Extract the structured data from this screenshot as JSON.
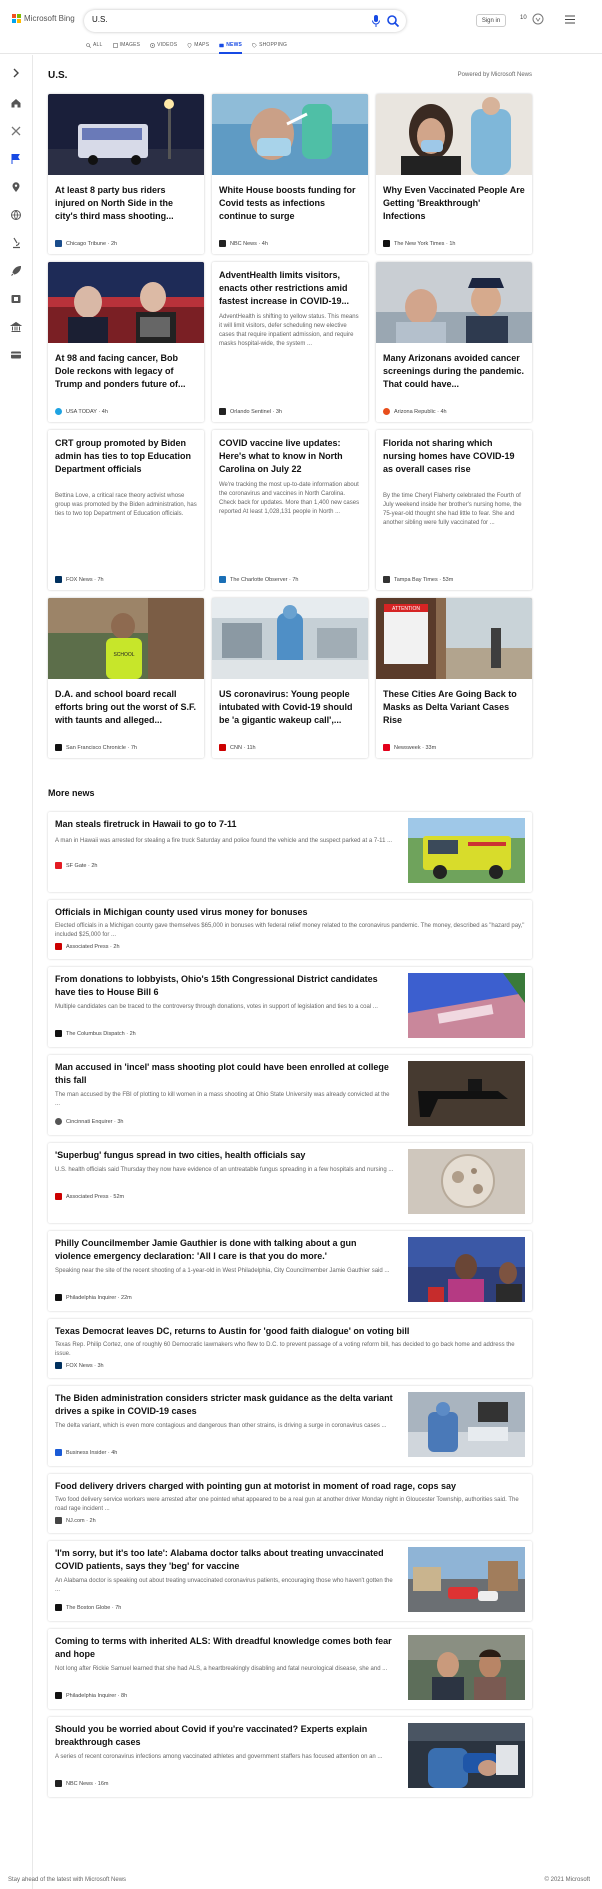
{
  "header": {
    "logo_text": "Microsoft Bing",
    "query": "U.S.",
    "signin": "Sign in",
    "rewards_points": "10",
    "tabs": [
      {
        "label": "ALL",
        "icon": "search-icon",
        "active": false
      },
      {
        "label": "IMAGES",
        "icon": "image-icon",
        "active": false
      },
      {
        "label": "VIDEOS",
        "icon": "video-icon",
        "active": false
      },
      {
        "label": "MAPS",
        "icon": "map-pin-icon",
        "active": false
      },
      {
        "label": "NEWS",
        "icon": "news-icon",
        "active": true
      },
      {
        "label": "SHOPPING",
        "icon": "tag-icon",
        "active": false
      }
    ]
  },
  "rail_icons": [
    "chevron-right-icon",
    "home-icon",
    "crosshair-icon",
    "flag-icon",
    "location-icon",
    "globe-icon",
    "microscope-icon",
    "rocket-icon",
    "film-icon",
    "building-icon",
    "card-icon"
  ],
  "section": {
    "title": "U.S.",
    "powered_by": "Powered by Microsoft News"
  },
  "top_cards": [
    {
      "title": "At least 8 party bus riders injured on North Side in the city's third mass shooting...",
      "source": "Chicago Tribune",
      "time": "2h",
      "fav": "#1a4c8b",
      "summary": ""
    },
    {
      "title": "White House boosts funding for Covid tests as infections continue to surge",
      "source": "NBC News",
      "time": "4h",
      "fav": "#222",
      "summary": ""
    },
    {
      "title": "Why Even Vaccinated People Are Getting 'Breakthrough' Infections",
      "source": "The New York Times",
      "time": "1h",
      "fav": "#111",
      "summary": ""
    },
    {
      "title": "At 98 and facing cancer, Bob Dole reckons with legacy of Trump and ponders future of...",
      "source": "USA TODAY",
      "time": "4h",
      "fav": "#1ea3e2",
      "summary": ""
    },
    {
      "title": "AdventHealth limits visitors, enacts other restrictions amid fastest increase in COVID-19...",
      "source": "Orlando Sentinel",
      "time": "3h",
      "fav": "#222",
      "summary": "AdventHealth is shifting to yellow status. This means it will limit visitors, defer scheduling new elective cases that require inpatient admission, and require masks hospital-wide, the system ..."
    },
    {
      "title": "Many Arizonans avoided cancer screenings during the pandemic. That could have...",
      "source": "Arizona Republic",
      "time": "4h",
      "fav": "#e84e1b",
      "summary": ""
    },
    {
      "title": "CRT group promoted by Biden admin has ties to top Education Department officials",
      "source": "FOX News",
      "time": "7h",
      "fav": "#00305e",
      "summary": "Bettina Love, a critical race theory activist whose group was promoted by the Biden administration, has ties to two top Department of Education officials."
    },
    {
      "title": "COVID vaccine live updates: Here's what to know in North Carolina on July 22",
      "source": "The Charlotte Observer",
      "time": "7h",
      "fav": "#1a6fb6",
      "summary": "We're tracking the most up-to-date information about the coronavirus and vaccines in North Carolina. Check back for updates. More than 1,400 new cases reported At least 1,028,131 people in North ..."
    },
    {
      "title": "Florida not sharing which nursing homes have COVID-19 as overall cases rise",
      "source": "Tampa Bay Times",
      "time": "53m",
      "fav": "#333",
      "summary": "By the time Cheryl Flaherty celebrated the Fourth of July weekend inside her brother's nursing home, the 75-year-old thought she had little to fear. She and another sibling were fully vaccinated for ..."
    },
    {
      "title": "D.A. and school board recall efforts bring out the worst of S.F. with taunts and alleged...",
      "source": "San Francisco Chronicle",
      "time": "7h",
      "fav": "#111",
      "summary": ""
    },
    {
      "title": "US coronavirus: Young people intubated with Covid-19 should be 'a gigantic wakeup call',...",
      "source": "CNN",
      "time": "11h",
      "fav": "#cc0000",
      "summary": ""
    },
    {
      "title": "These Cities Are Going Back to Masks as Delta Variant Cases Rise",
      "source": "Newsweek",
      "time": "33m",
      "fav": "#e3001b",
      "summary": ""
    }
  ],
  "more_news_title": "More news",
  "more_news": [
    {
      "title": "Man steals firetruck in Hawaii to go to 7-11",
      "summary": "A man in Hawaii was arrested for stealing a fire truck Saturday and police found the vehicle and the suspect parked at a 7-11 ...",
      "source": "SF Gate",
      "time": "2h",
      "fav": "#e31b23",
      "thumb": true
    },
    {
      "title": "Officials in Michigan county used virus money for bonuses",
      "summary": "Elected officials in a Michigan county gave themselves $65,000 in bonuses with federal relief money related to the coronavirus pandemic. The money, described as \"hazard pay,\" included $25,000 for ...",
      "source": "Associated Press",
      "time": "2h",
      "fav": "#c00",
      "thumb": false
    },
    {
      "title": "From donations to lobbyists, Ohio's 15th Congressional District candidates have ties to House Bill 6",
      "summary": "Multiple candidates can be traced to the controversy through donations, votes in support of legislation and ties to a coal ...",
      "source": "The Columbus Dispatch",
      "time": "2h",
      "fav": "#111",
      "thumb": true
    },
    {
      "title": "Man accused in 'incel' mass shooting plot could have been enrolled at college this fall",
      "summary": "The man accused by the FBI of plotting to kill women in a mass shooting at Ohio State University was already convicted at the ...",
      "source": "Cincinnati Enquirer",
      "time": "3h",
      "fav": "#555",
      "thumb": true
    },
    {
      "title": "'Superbug' fungus spread in two cities, health officials say",
      "summary": "U.S. health officials said Thursday they now have evidence of an untreatable fungus spreading in a few hospitals and nursing ...",
      "source": "Associated Press",
      "time": "52m",
      "fav": "#c00",
      "thumb": true
    },
    {
      "title": "Philly Councilmember Jamie Gauthier is done with talking about a gun violence emergency declaration: 'All I care is that you do more.'",
      "summary": "Speaking near the site of the recent shooting of a 1-year-old in West Philadelphia, City Councilmember Jamie Gauthier said ...",
      "source": "Philadelphia Inquirer",
      "time": "22m",
      "fav": "#111",
      "thumb": true
    },
    {
      "title": "Texas Democrat leaves DC, returns to Austin for 'good faith dialogue' on voting bill",
      "summary": "Texas Rep. Philip Cortez, one of roughly 60 Democratic lawmakers who flew to D.C. to prevent passage of a voting reform bill, has decided to go back home and address the issue.",
      "source": "FOX News",
      "time": "3h",
      "fav": "#00305e",
      "thumb": false
    },
    {
      "title": "The Biden administration considers stricter mask guidance as the delta variant drives a spike in COVID-19 cases",
      "summary": "The delta variant, which is even more contagious and dangerous than other strains, is driving a surge in coronavirus cases ...",
      "source": "Business Insider",
      "time": "4h",
      "fav": "#1a5bd6",
      "thumb": true
    },
    {
      "title": "Food delivery drivers charged with pointing gun at motorist in moment of road rage, cops say",
      "summary": "Two food delivery service workers were arrested after one pointed what appeared to be a real gun at another driver Monday night in Gloucester Township, authorities said. The road rage incident ...",
      "source": "NJ.com",
      "time": "2h",
      "fav": "#444",
      "thumb": false
    },
    {
      "title": "'I'm sorry, but it's too late': Alabama doctor talks about treating unvaccinated COVID patients, says they 'beg' for vaccine",
      "summary": "An Alabama doctor is speaking out about treating unvaccinated coronavirus patients, encouraging those who haven't gotten the ...",
      "source": "The Boston Globe",
      "time": "7h",
      "fav": "#111",
      "thumb": true
    },
    {
      "title": "Coming to terms with inherited ALS: With dreadful knowledge comes both fear and hope",
      "summary": "Not long after Rickie Samuel learned that she had ALS, a heartbreakingly disabling and fatal neurological disease, she and ...",
      "source": "Philadelphia Inquirer",
      "time": "8h",
      "fav": "#111",
      "thumb": true
    },
    {
      "title": "Should you be worried about Covid if you're vaccinated? Experts explain breakthrough cases",
      "summary": "A series of recent coronavirus infections among vaccinated athletes and government staffers has focused attention on an ...",
      "source": "NBC News",
      "time": "16m",
      "fav": "#222",
      "thumb": true
    }
  ],
  "footer": {
    "left": "Stay ahead of the latest with Microsoft News",
    "right": "© 2021 Microsoft"
  }
}
